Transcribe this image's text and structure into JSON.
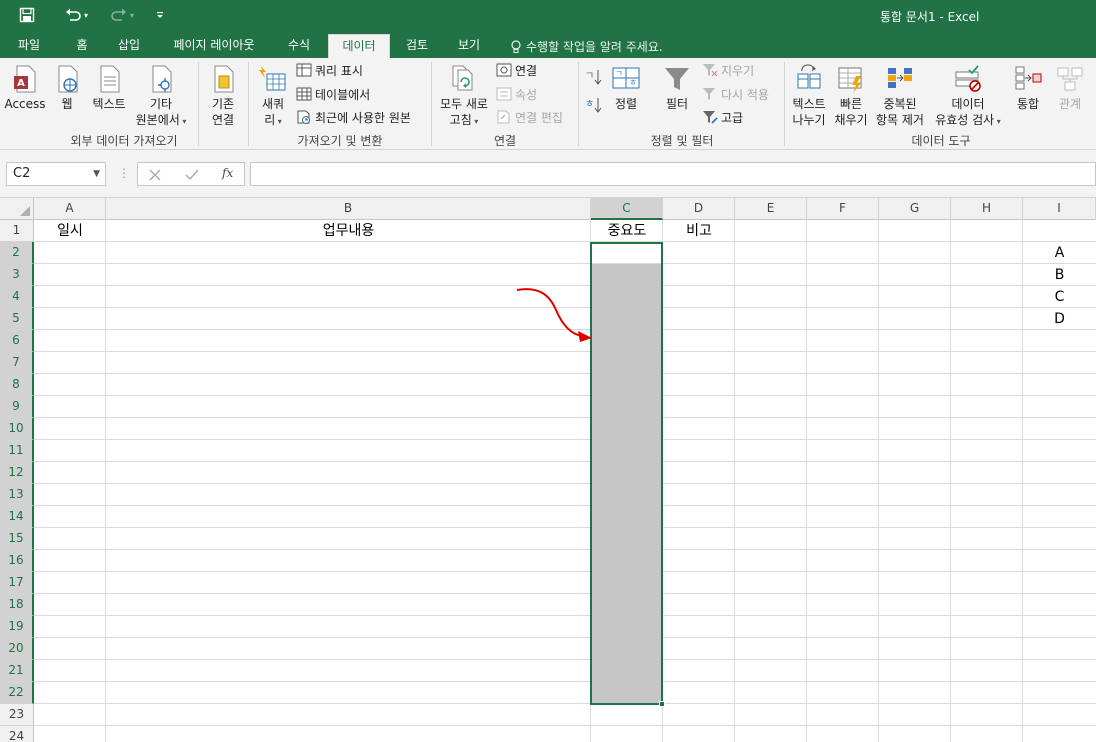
{
  "window": {
    "title": "통합 문서1 - Excel"
  },
  "tabs": [
    "파일",
    "홈",
    "삽입",
    "페이지 레이아웃",
    "수식",
    "데이터",
    "검토",
    "보기"
  ],
  "active_tab": "데이터",
  "tell_me": "수행할 작업을 알려 주세요.",
  "ribbon": {
    "external": {
      "access": "Access",
      "web": "웹",
      "text": "텍스트",
      "other_line1": "기타",
      "other_line2": "원본에서",
      "existing_line1": "기존",
      "existing_line2": "연결",
      "label": "외부 데이터 가져오기"
    },
    "get_transform": {
      "new_query_line1": "새쿼",
      "new_query_line2": "리",
      "show_queries": "쿼리 표시",
      "from_table": "테이블에서",
      "recent_sources": "최근에 사용한 원본",
      "label": "가져오기 및 변환"
    },
    "connections": {
      "refresh_line1": "모두 새로",
      "refresh_line2": "고침",
      "connections": "연결",
      "properties": "속성",
      "edit_links": "연결 편집",
      "label": "연결"
    },
    "sort_filter": {
      "sort": "정렬",
      "filter": "필터",
      "clear": "지우기",
      "reapply": "다시 적용",
      "advanced": "고급",
      "label": "정렬 및 필터"
    },
    "data_tools": {
      "text_to_col_line1": "텍스트",
      "text_to_col_line2": "나누기",
      "flash_fill_line1": "빠른",
      "flash_fill_line2": "채우기",
      "remove_dup_line1": "중복된",
      "remove_dup_line2": "항목 제거",
      "validation_line1": "데이터",
      "validation_line2": "유효성 검사",
      "consolidate": "통합",
      "relationships": "관계",
      "label": "데이터 도구"
    }
  },
  "formula_bar": {
    "name_box": "C2",
    "fx": "fx",
    "formula": ""
  },
  "columns": [
    "A",
    "B",
    "C",
    "D",
    "E",
    "F",
    "G",
    "H",
    "I"
  ],
  "selected_column": "C",
  "rows": [
    "1",
    "2",
    "3",
    "4",
    "5",
    "6",
    "7",
    "8",
    "9",
    "10",
    "11",
    "12",
    "13",
    "14",
    "15",
    "16",
    "17",
    "18",
    "19",
    "20",
    "21",
    "22",
    "23",
    "24"
  ],
  "selected_rows": [
    "2",
    "3",
    "4",
    "5",
    "6",
    "7",
    "8",
    "9",
    "10",
    "11",
    "12",
    "13",
    "14",
    "15",
    "16",
    "17",
    "18",
    "19",
    "20",
    "21",
    "22"
  ],
  "cells": {
    "A1": "일시",
    "B1": "업무내용",
    "C1": "중요도",
    "D1": "비고",
    "I2": "A",
    "I3": "B",
    "I4": "C",
    "I5": "D"
  },
  "selection_range": "C2:C22",
  "colors": {
    "accent": "#217346",
    "selection_fill": "#c6c6c6",
    "arrow": "#e00000"
  }
}
